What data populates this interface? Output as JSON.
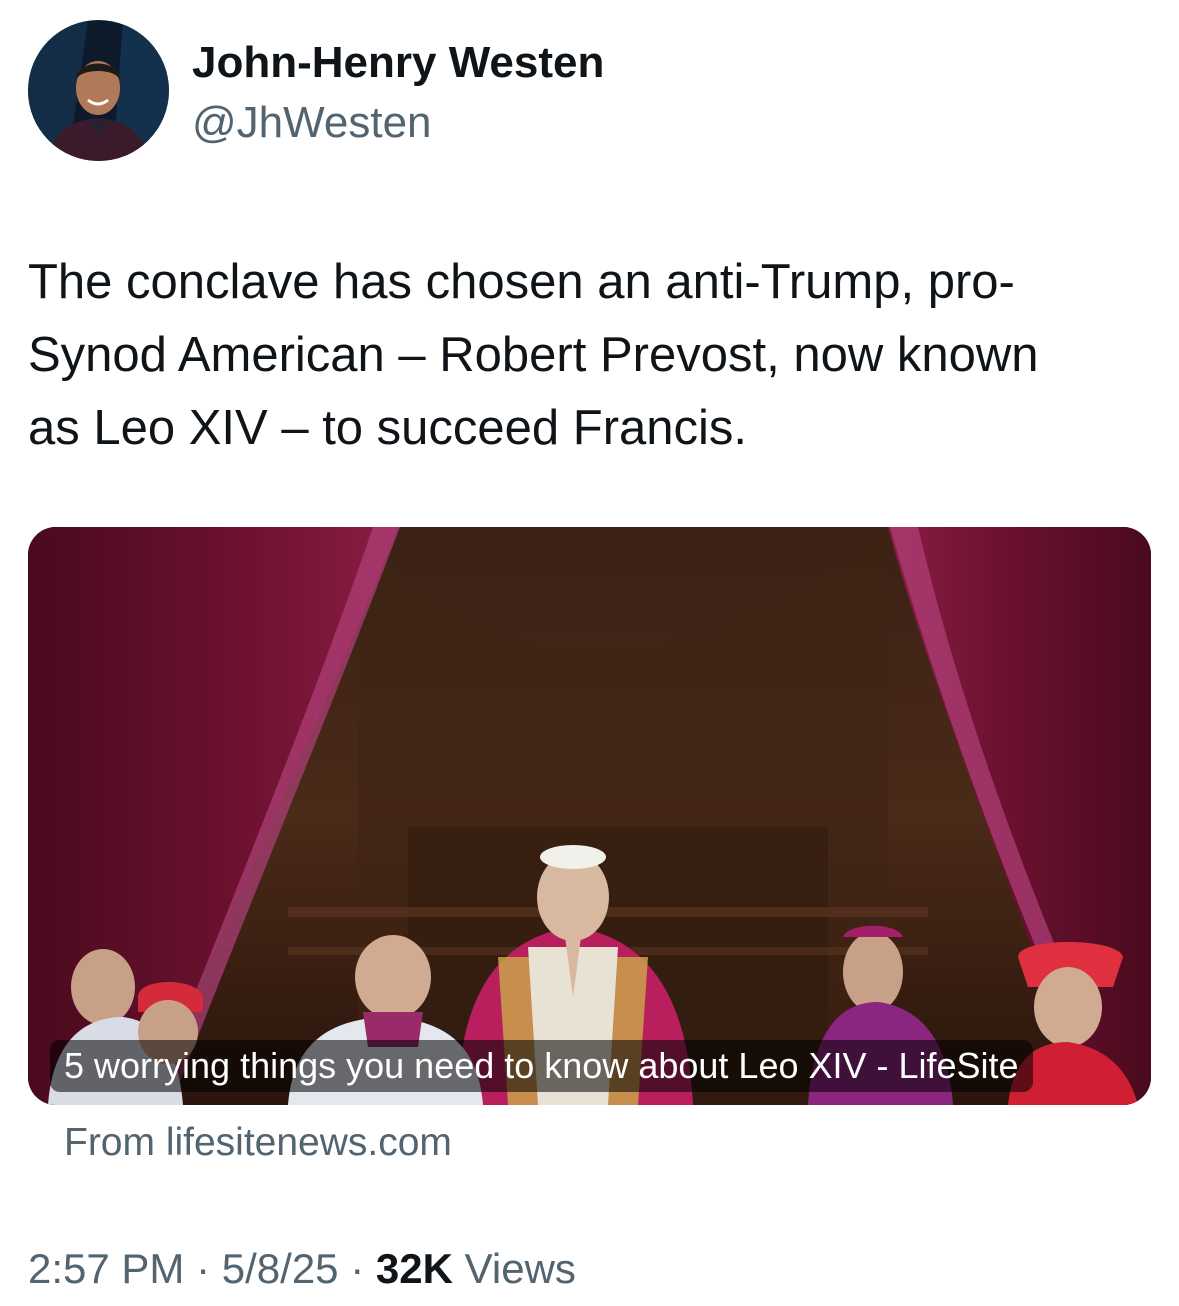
{
  "author": {
    "display_name": "John-Henry Westen",
    "handle": "@JhWesten"
  },
  "tweet": {
    "text": "The conclave has chosen an anti-Trump, pro-\nSynod American – Robert Prevost, now known\nas Leo XIV – to succeed Francis."
  },
  "card": {
    "title": "5 worrying things you need to know about Leo XIV - LifeSite",
    "source": "From lifesitenews.com"
  },
  "meta": {
    "time": "2:57 PM",
    "separator": "·",
    "date": "5/8/25",
    "views_count": "32K",
    "views_label": "Views"
  },
  "colors": {
    "text_primary": "#0f1419",
    "text_secondary": "#536471",
    "curtain": "#6e1230",
    "cassock": "#b81f5c"
  }
}
